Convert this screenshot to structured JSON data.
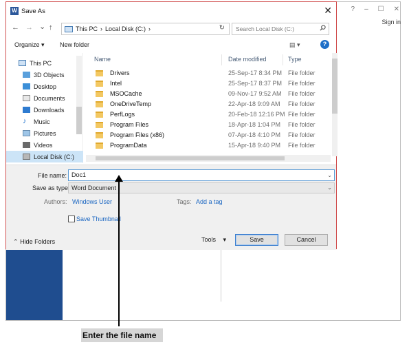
{
  "window": {
    "title": "Save As",
    "app_icon": "W",
    "close": "✕",
    "bg_controls": [
      "?",
      "–",
      "☐",
      "✕"
    ],
    "bg_signin": "Sign in"
  },
  "nav": {
    "back": "←",
    "forward": "→",
    "recent": "⌄",
    "up": "↑",
    "address": [
      "This PC",
      "›",
      "Local Disk (C:)",
      "›"
    ],
    "refresh": "↻",
    "search_placeholder": "Search Local Disk (C:)"
  },
  "toolbar": {
    "organize": "Organize ▾",
    "new_folder": "New folder",
    "view": "▤ ▾",
    "help": "?"
  },
  "tree": [
    {
      "label": "This PC",
      "icon": "computer-icon"
    },
    {
      "label": "3D Objects",
      "icon": "cube-icon"
    },
    {
      "label": "Desktop",
      "icon": "desktop-icon"
    },
    {
      "label": "Documents",
      "icon": "documents-icon"
    },
    {
      "label": "Downloads",
      "icon": "download-icon"
    },
    {
      "label": "Music",
      "icon": "music-icon"
    },
    {
      "label": "Pictures",
      "icon": "pictures-icon"
    },
    {
      "label": "Videos",
      "icon": "videos-icon"
    },
    {
      "label": "Local Disk (C:)",
      "icon": "drive-icon",
      "selected": true
    }
  ],
  "list": {
    "headers": {
      "name": "Name",
      "date": "Date modified",
      "type": "Type"
    },
    "rows": [
      {
        "name": "Drivers",
        "date": "25-Sep-17 8:34 PM",
        "type": "File folder"
      },
      {
        "name": "Intel",
        "date": "25-Sep-17 8:37 PM",
        "type": "File folder"
      },
      {
        "name": "MSOCache",
        "date": "09-Nov-17 9:52 AM",
        "type": "File folder"
      },
      {
        "name": "OneDriveTemp",
        "date": "22-Apr-18 9:09 AM",
        "type": "File folder"
      },
      {
        "name": "PerfLogs",
        "date": "20-Feb-18 12:16 PM",
        "type": "File folder"
      },
      {
        "name": "Program Files",
        "date": "18-Apr-18 1:04 PM",
        "type": "File folder"
      },
      {
        "name": "Program Files (x86)",
        "date": "07-Apr-18 4:10 PM",
        "type": "File folder"
      },
      {
        "name": "ProgramData",
        "date": "15-Apr-18 9:40 PM",
        "type": "File folder"
      }
    ]
  },
  "form": {
    "file_name_label": "File name:",
    "file_name_value": "Doc1",
    "save_type_label": "Save as type:",
    "save_type_value": "Word Document",
    "authors_label": "Authors:",
    "authors_value": "Windows User",
    "tags_label": "Tags:",
    "tags_value": "Add a tag",
    "thumbnail_label": "Save Thumbnail",
    "hide_folders": "Hide Folders",
    "tools": "Tools",
    "save": "Save",
    "cancel": "Cancel"
  },
  "annotation": {
    "caption": "Enter the file name"
  },
  "colors": {
    "accent": "#1a66c2",
    "dialog_border": "#d04b4b",
    "word_blue": "#1f4d8f"
  }
}
